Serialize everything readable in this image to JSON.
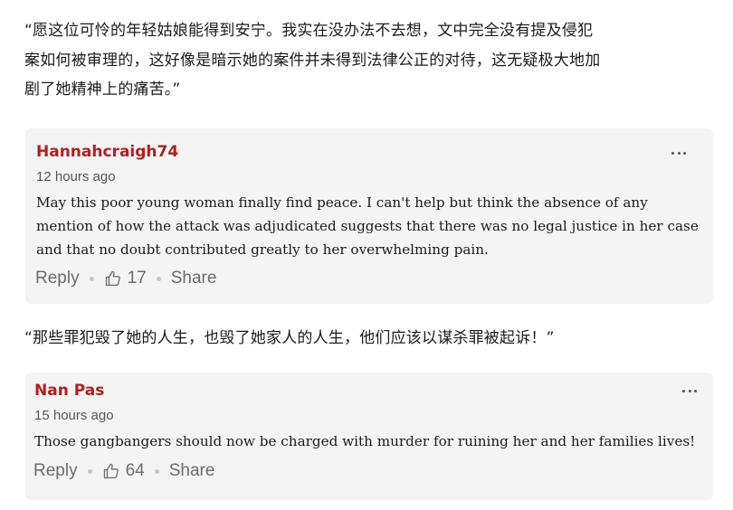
{
  "translations": [
    {
      "lines": [
        "“愿这位可怜的年轻姑娘能得到安宁。我实在没办法不去想，文中完全没有提及侵犯",
        "案如何被审理的，这好像是暗示她的案件并未得到法律公正的对待，这无疑极大地加",
        "剧了她精神上的痛苦。”"
      ]
    },
    {
      "lines": [
        "“那些罪犯毁了她的人生，也毁了她家人的人生，他们应该以谋杀罪被起诉！”"
      ]
    }
  ],
  "comments": [
    {
      "author": "Hannahcraigh74",
      "time": "12 hours ago",
      "lines": [
        "May this poor young woman finally find peace.  I can't help but think the absence of any",
        "mention of how the attack was adjudicated suggests that there was no legal justice in her case",
        "and that no doubt contributed greatly to her overwhelming pain."
      ],
      "reply_label": "Reply",
      "like_count": "17",
      "share_label": "Share"
    },
    {
      "author": "Nan Pas",
      "time": "15 hours ago",
      "lines": [
        "Those gangbangers should now be charged with murder for ruining her and her families lives!"
      ],
      "reply_label": "Reply",
      "like_count": "64",
      "share_label": "Share"
    }
  ],
  "icons": {
    "like": "thumbs-up-icon",
    "more": "more-options-icon"
  },
  "colors": {
    "author": "#b01e1e",
    "card_background": "#f4f4f4",
    "action_text": "#6b6b6b"
  }
}
